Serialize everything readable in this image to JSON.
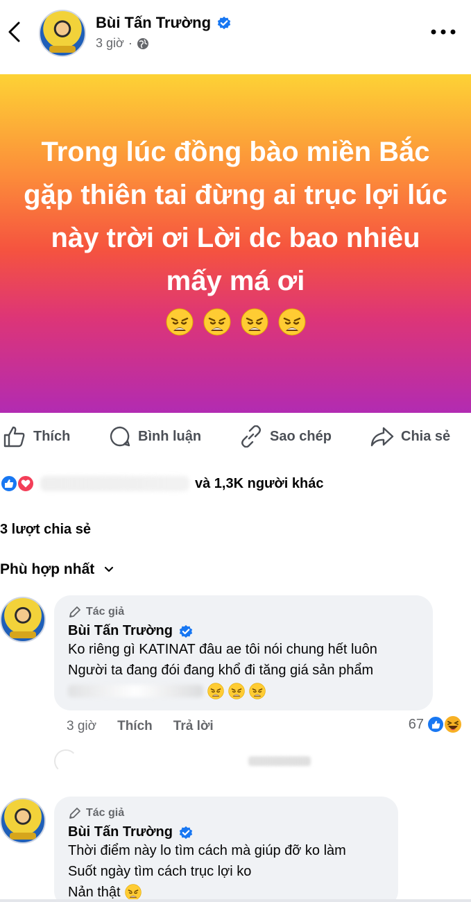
{
  "header": {
    "author": "Bùi Tấn Trường",
    "time": "3 giờ",
    "separator": "·"
  },
  "post": {
    "text": "Trong lúc đồng bào miền Bắc gặp thiên tai đừng ai trục lợi lúc này trời ơi Lời dc bao nhiêu mấy má ơi",
    "emoji": "😩😩😩😩",
    "background": [
      "#fdd235",
      "#fc8c3a",
      "#f5533f",
      "#dd3577",
      "#b22bb2"
    ]
  },
  "actions": {
    "like": "Thích",
    "comment": "Bình luận",
    "copy": "Sao chép",
    "share": "Chia sẻ"
  },
  "reactions": {
    "summary": "và 1,3K người khác"
  },
  "shares": "3 lượt chia sẻ",
  "sort": "Phù hợp nhất",
  "comments": [
    {
      "badge": "Tác giả",
      "author": "Bùi Tấn Trường",
      "lines": [
        "Ko riêng gì KATINAT đâu ae tôi nói chung hết luôn",
        "Người ta đang đói đang khổ đi tăng giá sản phẩm"
      ],
      "time": "3 giờ",
      "like_label": "Thích",
      "reply_label": "Trả lời",
      "reaction_count": "67"
    },
    {
      "badge": "Tác giả",
      "author": "Bùi Tấn Trường",
      "lines": [
        "Thời điểm này lo tìm cách mà giúp đỡ ko làm",
        "Suốt ngày tìm cách trục lợi ko",
        "Nản thật"
      ]
    }
  ],
  "colors": {
    "accent": "#1877f2",
    "love": "#f33e58",
    "bubble": "#f0f2f5",
    "muted": "#65676b"
  }
}
